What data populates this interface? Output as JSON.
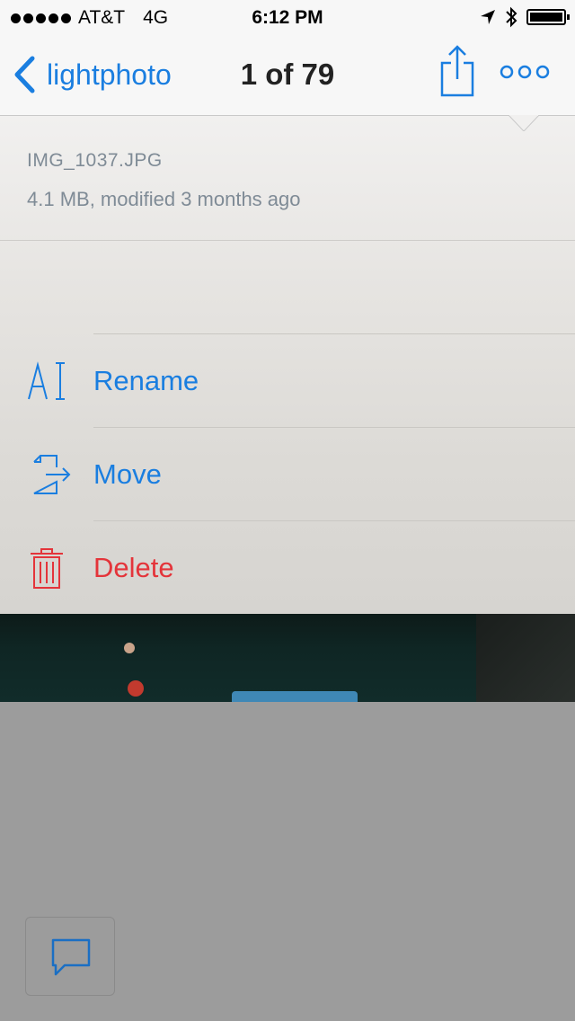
{
  "status_bar": {
    "carrier": "AT&T",
    "network": "4G",
    "time": "6:12 PM"
  },
  "nav": {
    "back_label": "lightphoto",
    "title": "1 of 79"
  },
  "file": {
    "name": "IMG_1037.JPG",
    "meta": "4.1 MB, modified 3 months ago"
  },
  "menu": {
    "rename": "Rename",
    "move": "Move",
    "delete": "Delete"
  },
  "colors": {
    "accent": "#1a7ee0",
    "destructive": "#e4343a"
  },
  "icons": {
    "back": "chevron-left-icon",
    "share": "share-icon",
    "more": "more-icon",
    "rename": "rename-icon",
    "move": "move-icon",
    "delete": "trash-icon",
    "comment": "comment-icon"
  }
}
